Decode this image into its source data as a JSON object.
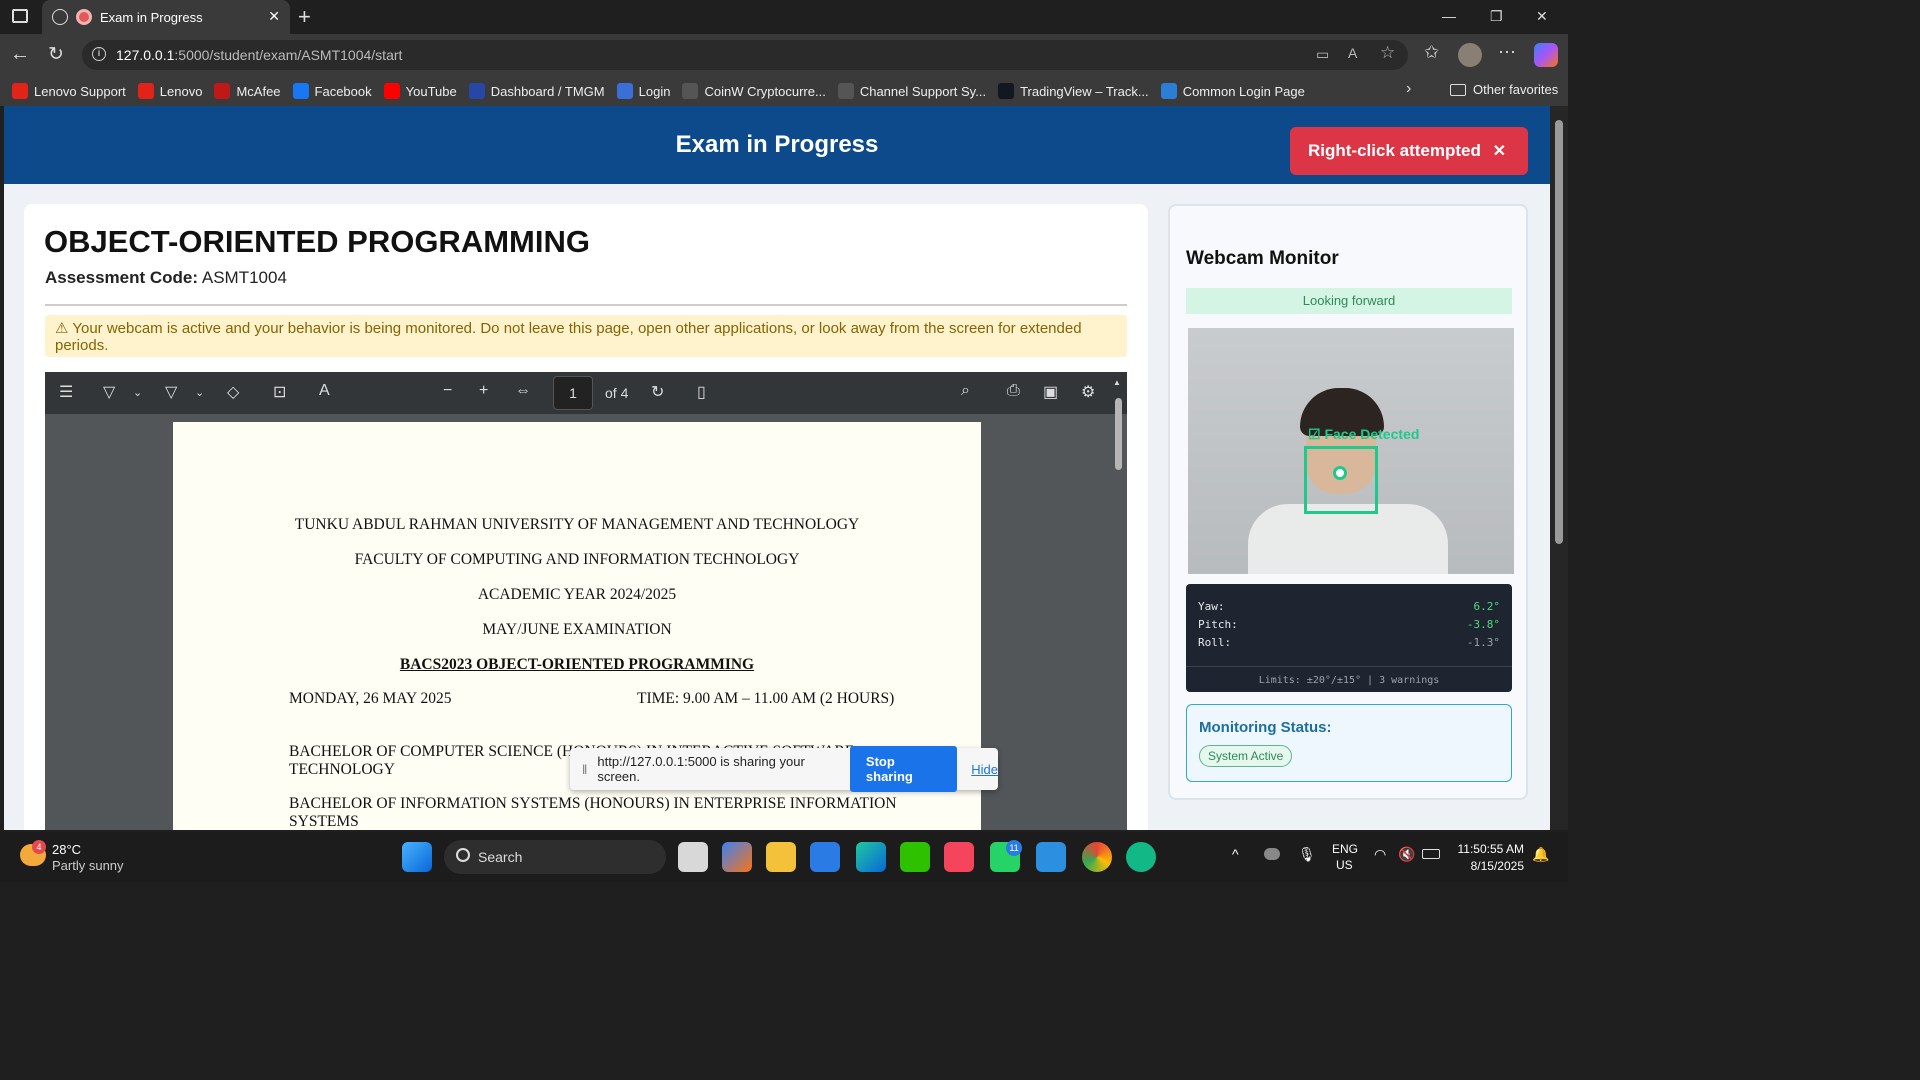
{
  "browser": {
    "tab_title": "Exam in Progress",
    "url_host": "127.0.0.1",
    "url_path": ":5000/student/exam/ASMT1004/start",
    "bookmarks": [
      {
        "label": "Lenovo Support",
        "icon": "lenovo-icon",
        "color": "#e2231a"
      },
      {
        "label": "Lenovo",
        "icon": "lenovo-icon",
        "color": "#e2231a"
      },
      {
        "label": "McAfee",
        "icon": "mcafee-icon",
        "color": "#c01818"
      },
      {
        "label": "Facebook",
        "icon": "facebook-icon",
        "color": "#1877f2"
      },
      {
        "label": "YouTube",
        "icon": "youtube-icon",
        "color": "#ff0000"
      },
      {
        "label": "Dashboard / TMGM",
        "icon": "tmgm-icon",
        "color": "#2747a6"
      },
      {
        "label": "Login",
        "icon": "login-icon",
        "color": "#3a6fd8"
      },
      {
        "label": "CoinW Cryptocurre...",
        "icon": "globe-icon",
        "color": "#555555"
      },
      {
        "label": "Channel Support Sy...",
        "icon": "globe-icon",
        "color": "#555555"
      },
      {
        "label": "TradingView – Track...",
        "icon": "tradingview-icon",
        "color": "#131722"
      },
      {
        "label": "Common Login Page",
        "icon": "common-login-icon",
        "color": "#2a7fd4"
      }
    ],
    "other_favorites": "Other favorites"
  },
  "page": {
    "header_title": "Exam in Progress",
    "toast": "Right-click attempted",
    "course_title": "OBJECT-ORIENTED PROGRAMMING",
    "code_label": "Assessment Code:",
    "code_value": "ASMT1004",
    "warning": "⚠ Your webcam is active and your behavior is being monitored. Do not leave this page, open other applications, or look away from the screen for extended periods."
  },
  "pdf": {
    "page_number": "1",
    "page_total": "of 4",
    "lines": {
      "university": "TUNKU ABDUL RAHMAN UNIVERSITY OF MANAGEMENT AND TECHNOLOGY",
      "faculty": "FACULTY OF COMPUTING AND INFORMATION TECHNOLOGY",
      "year": "ACADEMIC YEAR 2024/2025",
      "exam": "MAY/JUNE EXAMINATION",
      "course": "BACS2023 OBJECT-ORIENTED PROGRAMMING",
      "date": "MONDAY, 26 MAY 2025",
      "time": "TIME: 9.00 AM – 11.00 AM (2 HOURS)",
      "prog1a": "BACHELOR OF COMPUTER SCIENCE (HONOURS) IN INTERACTIVE SOFTWARE",
      "prog1b": "TECHNOLOGY",
      "prog2a": "BACHELOR OF INFORMATION SYSTEMS (HONOURS) IN ENTERPRISE INFORMATION",
      "prog2b": "SYSTEMS"
    }
  },
  "share_bar": {
    "message": "http://127.0.0.1:5000 is sharing your screen.",
    "stop": "Stop sharing",
    "hide": "Hide"
  },
  "webcam": {
    "title": "Webcam Monitor",
    "status": "Looking forward",
    "face_label": "Face Detected",
    "yaw_label": "Yaw:",
    "yaw": "6.2°",
    "pitch_label": "Pitch:",
    "pitch": "-3.8°",
    "roll_label": "Roll:",
    "roll": "-1.3°",
    "limits": "Limits: ±20°/±15° | 3 warnings",
    "monitoring_title": "Monitoring Status:",
    "monitoring_chip": "System Active"
  },
  "taskbar": {
    "temperature": "28°C",
    "weather": "Partly sunny",
    "weather_badge": "4",
    "search": "Search",
    "lang": "ENG",
    "region": "US",
    "time": "11:50:55 AM",
    "date": "8/15/2025",
    "whatsapp_badge": "11"
  },
  "colors": {
    "header": "#0d4a8c",
    "toast": "#dc3545",
    "face_box": "#1ec98b"
  }
}
